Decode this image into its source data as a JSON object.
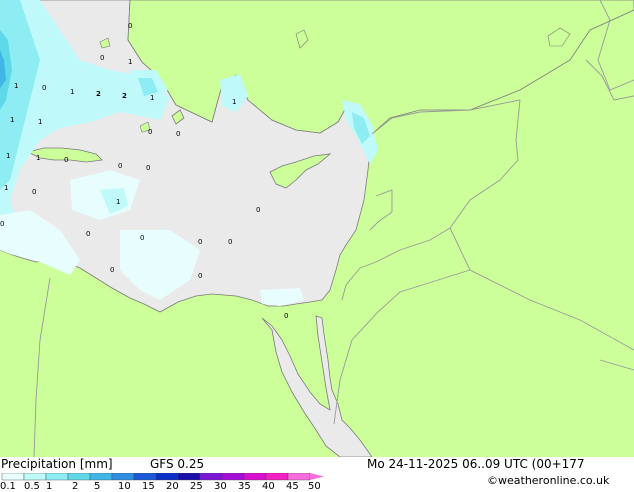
{
  "map": {
    "colors": {
      "land": "#ccff99",
      "sea": "#eaeaea",
      "border": "#999999",
      "coast": "#7a7a7a"
    },
    "rain_labels": [
      "0",
      "0",
      "1",
      "0",
      "2",
      "1",
      "1",
      "2",
      "1",
      "1",
      "1",
      "0",
      "1",
      "1",
      "0",
      "1",
      "0",
      "0",
      "0",
      "1",
      "0",
      "0",
      "0",
      "0",
      "0",
      "0",
      "0",
      "0",
      "1",
      "0",
      "0"
    ]
  },
  "footer": {
    "title": "Precipitation [mm]",
    "model": "GFS 0.25",
    "datetime": "Mo 24-11-2025 06..09 UTC (00+177",
    "copyright": "©weatheronline.co.uk",
    "scale_labels": [
      "0.1",
      "0.5",
      "1",
      "2",
      "5",
      "10",
      "15",
      "20",
      "25",
      "30",
      "35",
      "40",
      "45",
      "50"
    ],
    "scale_colors": [
      "#e8fdfd",
      "#bff9f9",
      "#8eedf2",
      "#5fd8e8",
      "#3fb6e6",
      "#2e8fe0",
      "#1b59d6",
      "#0c2fc5",
      "#1a0fa9",
      "#7b17d6",
      "#a40fd6",
      "#d70fd0",
      "#f21fc2",
      "#f86cdc"
    ]
  }
}
